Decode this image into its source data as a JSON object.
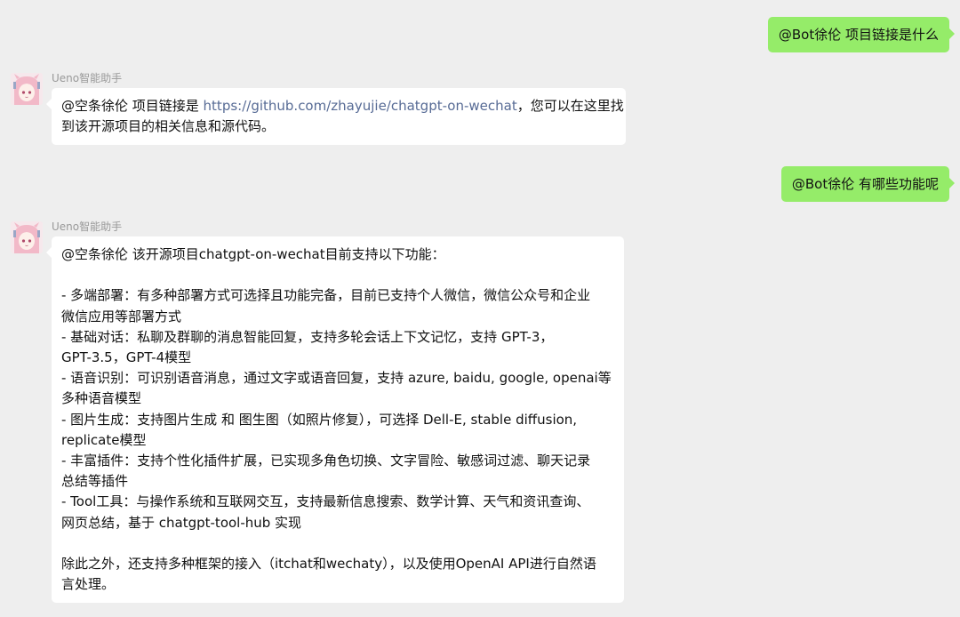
{
  "colors": {
    "background": "#eeeeee",
    "outgoing_bubble": "#95ec69",
    "incoming_bubble": "#ffffff",
    "link": "#576b95",
    "sender_name": "#999999"
  },
  "messages": {
    "m1": {
      "text": "@Bot徐伦 项目链接是什么"
    },
    "m2": {
      "sender": "Ueno智能助手",
      "prefix": "@空条徐伦 项目链接是 ",
      "link": "https://github.com/zhayujie/chatgpt-on-wechat",
      "suffix": "，您可以在这里找",
      "line2": "到该开源项目的相关信息和源代码。"
    },
    "m3": {
      "text": "@Bot徐伦 有哪些功能呢"
    },
    "m4": {
      "sender": "Ueno智能助手",
      "lines": [
        "@空条徐伦 该开源项目chatgpt-on-wechat目前支持以下功能：",
        "",
        "- 多端部署：有多种部署方式可选择且功能完备，目前已支持个人微信，微信公众号和企业",
        "微信应用等部署方式",
        "- 基础对话：私聊及群聊的消息智能回复，支持多轮会话上下文记忆，支持 GPT-3，",
        "GPT-3.5，GPT-4模型",
        "- 语音识别：可识别语音消息，通过文字或语音回复，支持 azure, baidu, google, openai等",
        "多种语音模型",
        "- 图片生成：支持图片生成 和 图生图（如照片修复），可选择 Dell-E, stable diffusion,",
        "replicate模型",
        "- 丰富插件：支持个性化插件扩展，已实现多角色切换、文字冒险、敏感词过滤、聊天记录",
        "总结等插件",
        "- Tool工具：与操作系统和互联网交互，支持最新信息搜索、数学计算、天气和资讯查询、",
        "网页总结，基于 chatgpt-tool-hub 实现",
        "",
        "除此之外，还支持多种框架的接入（itchat和wechaty），以及使用OpenAI API进行自然语",
        "言处理。"
      ]
    }
  }
}
